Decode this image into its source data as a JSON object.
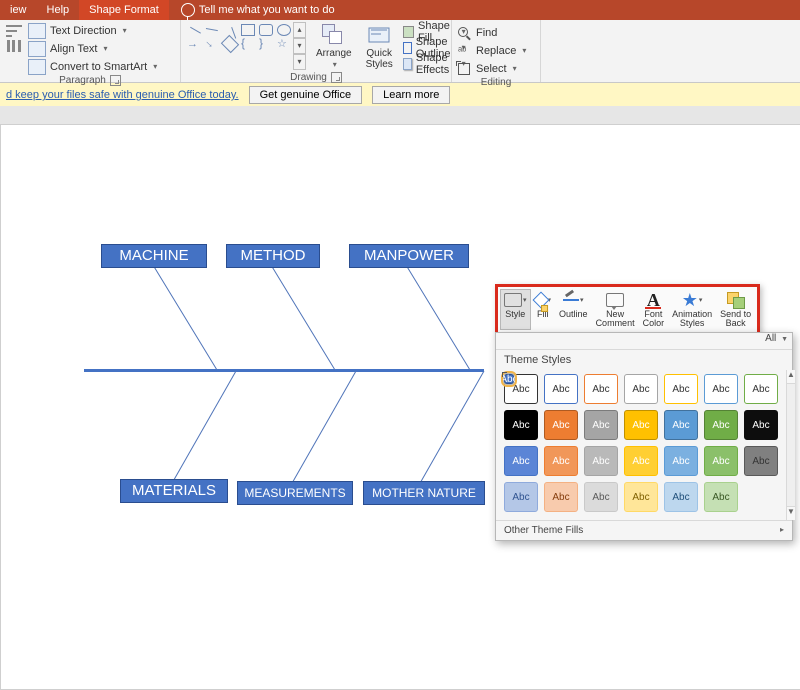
{
  "tabs": {
    "iew": "iew",
    "help": "Help",
    "shapeFormat": "Shape Format",
    "tellMe": "Tell me what you want to do"
  },
  "ribbon": {
    "paragraph": {
      "label": "Paragraph",
      "textDirection": "Text Direction",
      "alignText": "Align Text",
      "convertSmartArt": "Convert to SmartArt"
    },
    "drawing": {
      "label": "Drawing",
      "arrange": "Arrange",
      "quickStyles": "Quick\nStyles",
      "shapeFill": "Shape Fill",
      "shapeOutline": "Shape Outline",
      "shapeEffects": "Shape Effects"
    },
    "editing": {
      "label": "Editing",
      "find": "Find",
      "replace": "Replace",
      "select": "Select"
    }
  },
  "banner": {
    "text": "d keep your files safe with genuine Office today.",
    "btn1": "Get genuine Office",
    "btn2": "Learn more"
  },
  "diagram": {
    "top": [
      "MACHINE",
      "METHOD",
      "MANPOWER"
    ],
    "bottom": [
      "MATERIALS",
      "MEASUREMENTS",
      "MOTHER NATURE"
    ]
  },
  "floatbar": {
    "style": "Style",
    "fill": "Fill",
    "outline": "Outline",
    "newComment": "New\nComment",
    "fontColor": "Font\nColor",
    "animStyles": "Animation\nStyles",
    "sendBack": "Send to\nBack"
  },
  "gallery": {
    "all": "All",
    "header": "Theme Styles",
    "footer": "Other Theme Fills",
    "abc": "Abc",
    "rows": [
      [
        {
          "bg": "#ffffff",
          "fg": "#333333",
          "border": "#333333"
        },
        {
          "bg": "#ffffff",
          "fg": "#333333",
          "border": "#4472c4"
        },
        {
          "bg": "#ffffff",
          "fg": "#333333",
          "border": "#ed7d31"
        },
        {
          "bg": "#ffffff",
          "fg": "#333333",
          "border": "#a5a5a5"
        },
        {
          "bg": "#ffffff",
          "fg": "#333333",
          "border": "#ffc000"
        },
        {
          "bg": "#ffffff",
          "fg": "#333333",
          "border": "#5b9bd5"
        },
        {
          "bg": "#ffffff",
          "fg": "#333333",
          "border": "#70ad47"
        }
      ],
      [
        {
          "bg": "#000000",
          "fg": "#ffffff",
          "border": "#000000"
        },
        {
          "bg": "#4472c4",
          "fg": "#ffffff",
          "border": "#2f528f",
          "selected": true
        },
        {
          "bg": "#ed7d31",
          "fg": "#ffffff",
          "border": "#ae5a21"
        },
        {
          "bg": "#a5a5a5",
          "fg": "#ffffff",
          "border": "#7b7b7b"
        },
        {
          "bg": "#ffc000",
          "fg": "#ffffff",
          "border": "#bf9000"
        },
        {
          "bg": "#5b9bd5",
          "fg": "#ffffff",
          "border": "#41719c"
        },
        {
          "bg": "#70ad47",
          "fg": "#ffffff",
          "border": "#548235"
        }
      ],
      [
        {
          "bg": "#0d0d0d",
          "fg": "#ffffff",
          "border": "#0d0d0d"
        },
        {
          "bg": "#5b85d6",
          "fg": "#ffffff",
          "border": "#4472c4"
        },
        {
          "bg": "#f19759",
          "fg": "#ffffff",
          "border": "#ed7d31"
        },
        {
          "bg": "#b9b9b9",
          "fg": "#ffffff",
          "border": "#a5a5a5"
        },
        {
          "bg": "#ffcf33",
          "fg": "#ffffff",
          "border": "#ffc000"
        },
        {
          "bg": "#7bb0e0",
          "fg": "#ffffff",
          "border": "#5b9bd5"
        },
        {
          "bg": "#8bc06a",
          "fg": "#ffffff",
          "border": "#70ad47"
        }
      ],
      [
        {
          "bg": "#808080",
          "fg": "#333333",
          "border": "#595959"
        },
        {
          "bg": "#b4c7e7",
          "fg": "#2f528f",
          "border": "#8faadc"
        },
        {
          "bg": "#f8cbad",
          "fg": "#843c0c",
          "border": "#f4b183"
        },
        {
          "bg": "#dbdbdb",
          "fg": "#595959",
          "border": "#c9c9c9"
        },
        {
          "bg": "#ffe699",
          "fg": "#7f6000",
          "border": "#ffd966"
        },
        {
          "bg": "#bdd7ee",
          "fg": "#1f4e79",
          "border": "#9dc3e6"
        },
        {
          "bg": "#c5e0b4",
          "fg": "#385723",
          "border": "#a9d18e"
        }
      ]
    ]
  }
}
